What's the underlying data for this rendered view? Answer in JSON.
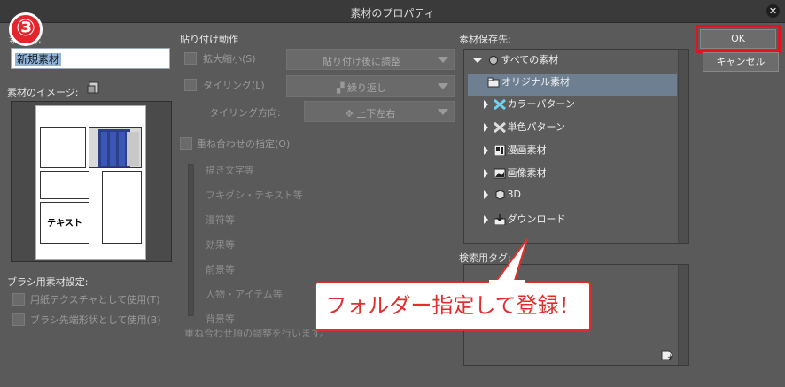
{
  "window": {
    "title": "素材のプロパティ"
  },
  "annotation": {
    "step_badge": "③",
    "callout_text": "フォルダー指定して登録！"
  },
  "left": {
    "name_label": "素材名:",
    "name_value": "新規素材",
    "image_label": "素材のイメージ:",
    "preview_text": "テキスト",
    "brush_section_label": "ブラシ用素材設定:",
    "brush_options": [
      "用紙テクスチャとして使用(T)",
      "ブラシ先端形状として使用(B)"
    ]
  },
  "paste": {
    "section_label": "貼り付け動作",
    "scale_label": "拡大縮小(S)",
    "scale_value": "貼り付け後に調整",
    "tiling_label": "タイリング(L)",
    "tiling_value": "繰り返し",
    "tiling_dir_label": "タイリング方向:",
    "tiling_dir_value": "上下左右",
    "overlay_label": "重ね合わせの指定(O)",
    "overlay_items": [
      "描き文字等",
      "フキダシ・テキスト等",
      "漫符等",
      "効果等",
      "前景等",
      "人物・アイテム等",
      "背景等"
    ],
    "overlay_note": "重ね合わせ順の調整を行います。"
  },
  "storage": {
    "label": "素材保存先:",
    "root": "すべての素材",
    "items": [
      {
        "label": "オリジナル素材",
        "icon": "folder-icon",
        "selected": true
      },
      {
        "label": "カラーパターン",
        "icon": "color-pattern-icon"
      },
      {
        "label": "単色パターン",
        "icon": "mono-pattern-icon"
      },
      {
        "label": "漫画素材",
        "icon": "manga-icon"
      },
      {
        "label": "画像素材",
        "icon": "image-icon"
      },
      {
        "label": "3D",
        "icon": "cube-icon"
      },
      {
        "label": "ダウンロード",
        "icon": "download-icon"
      }
    ],
    "tag_label": "検索用タグ:"
  },
  "buttons": {
    "ok": "OK",
    "cancel": "キャンセル"
  },
  "colors": {
    "highlight_red": "#e0141e",
    "selected_row": "#6e7f92",
    "dialog_bg": "#5a5a5a"
  }
}
